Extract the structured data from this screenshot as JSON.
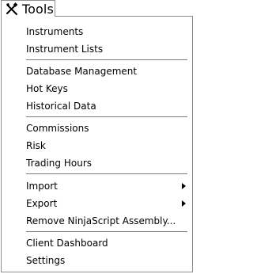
{
  "menu": {
    "title": "Tools",
    "icon": "tools-icon",
    "items": [
      {
        "label": "Instruments"
      },
      {
        "label": "Instrument Lists"
      },
      {
        "label": "Database Management"
      },
      {
        "label": "Hot Keys"
      },
      {
        "label": "Historical Data"
      },
      {
        "label": "Commissions"
      },
      {
        "label": "Risk"
      },
      {
        "label": "Trading Hours"
      },
      {
        "label": "Import",
        "icon": "chevron-right-icon"
      },
      {
        "label": "Export",
        "icon": "chevron-right-icon"
      },
      {
        "label": "Remove NinjaScript Assembly..."
      },
      {
        "label": "Client Dashboard"
      },
      {
        "label": "Settings"
      }
    ]
  }
}
